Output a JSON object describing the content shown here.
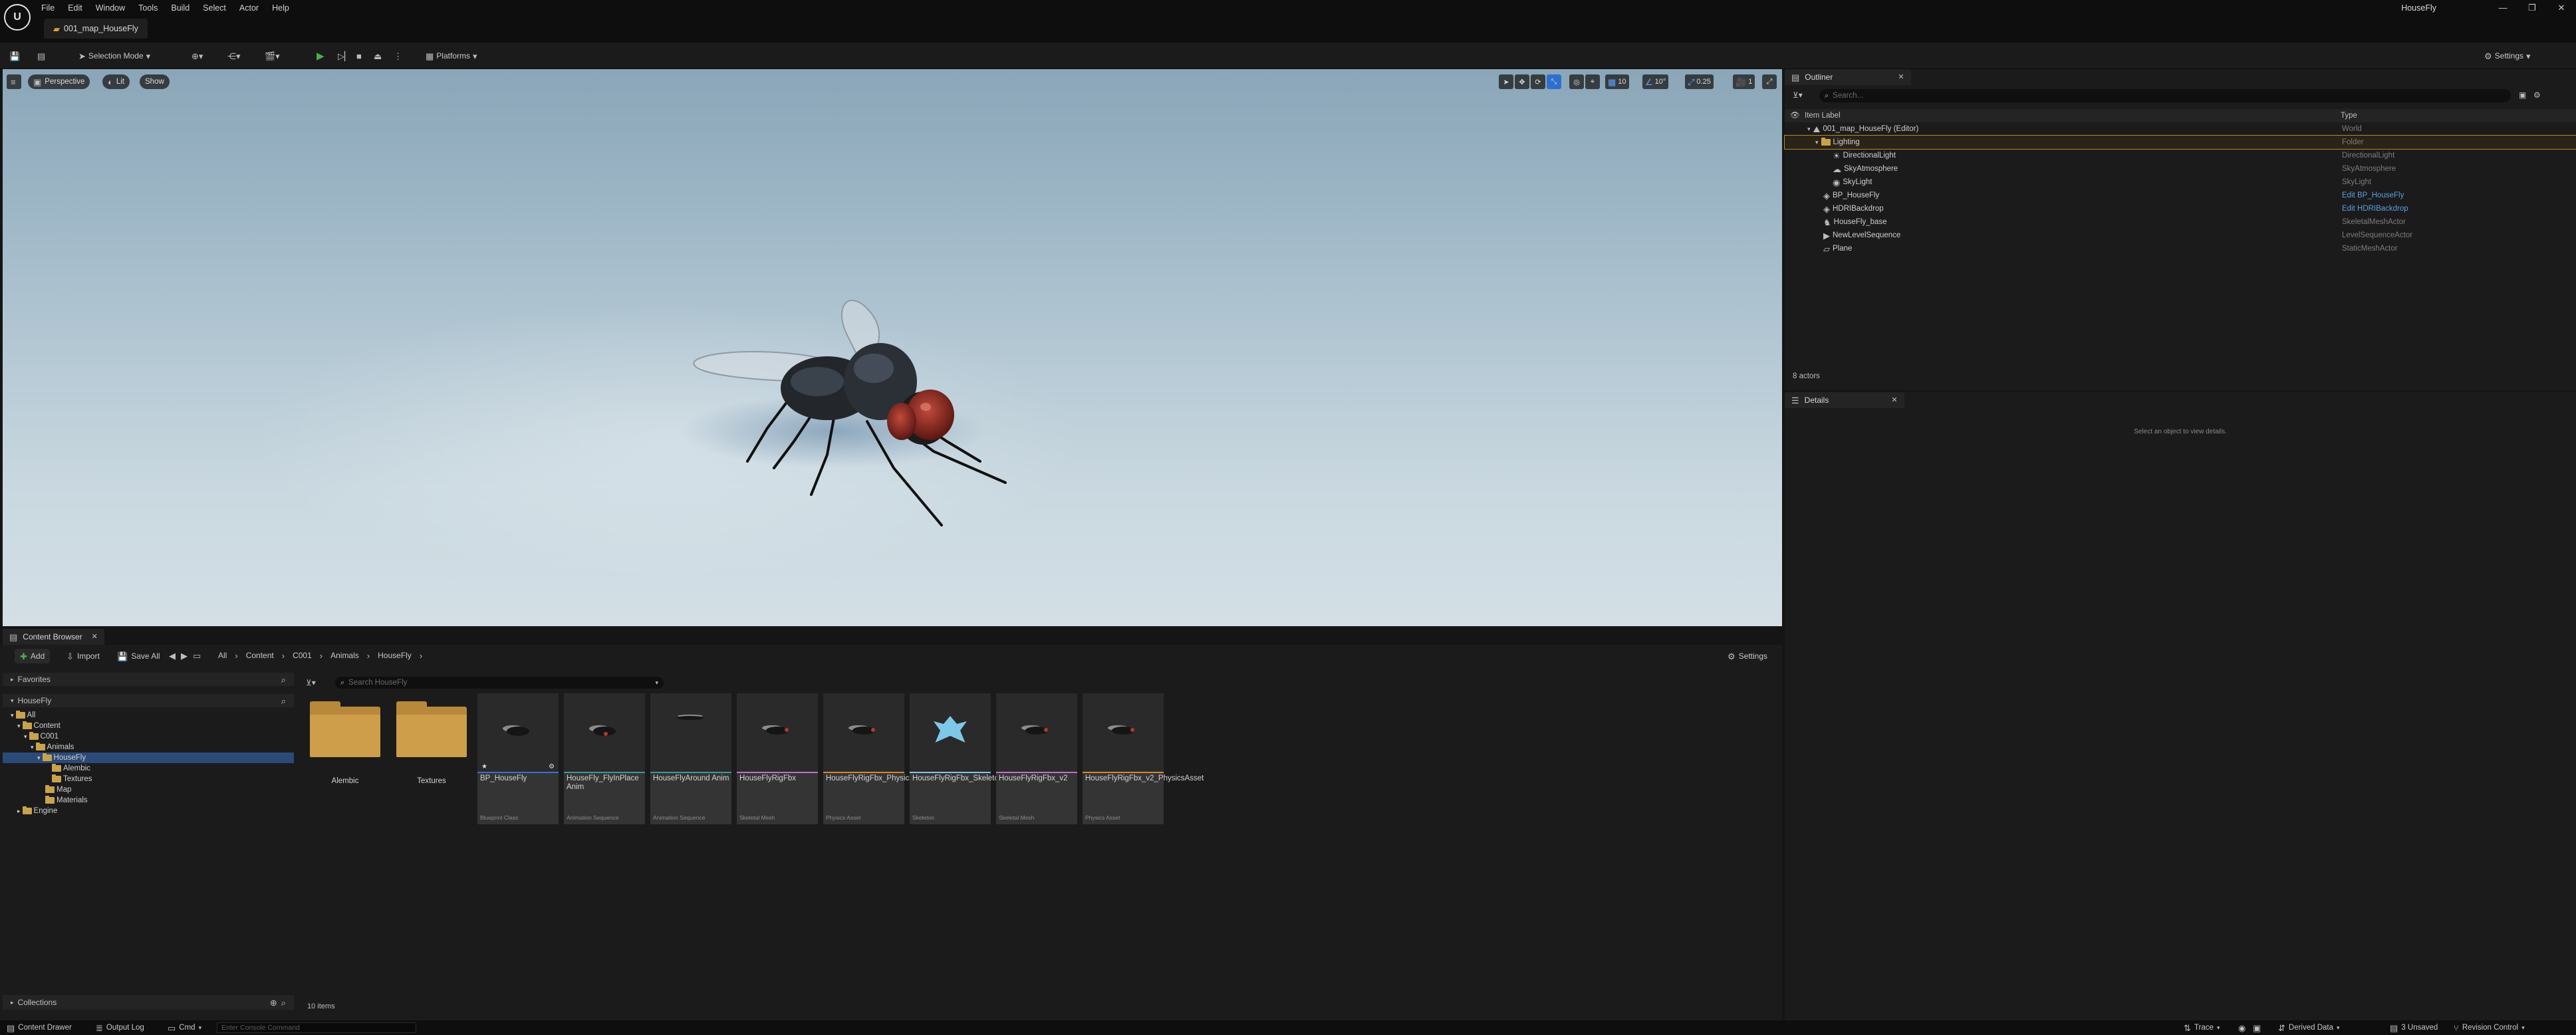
{
  "menu": [
    "File",
    "Edit",
    "Window",
    "Tools",
    "Build",
    "Select",
    "Actor",
    "Help"
  ],
  "window_title": "HouseFly",
  "window_controls": [
    "—",
    "❐",
    "✕"
  ],
  "map_tab": "001_map_HouseFly",
  "toolbar": {
    "selection_mode": "Selection Mode",
    "platforms": "Platforms",
    "settings": "Settings"
  },
  "viewport": {
    "perspective": "Perspective",
    "lit": "Lit",
    "show": "Show",
    "grid_snap": "10",
    "angle_snap": "10°",
    "scale_snap": "0.25",
    "camera_speed": "1"
  },
  "outliner": {
    "tab": "Outliner",
    "search_placeholder": "Search...",
    "col_label": "Item Label",
    "col_type": "Type",
    "items": [
      {
        "label": "001_map_HouseFly (Editor)",
        "type": "World"
      },
      {
        "label": "Lighting",
        "type": "Folder"
      },
      {
        "label": "DirectionalLight",
        "type": "DirectionalLight"
      },
      {
        "label": "SkyAtmosphere",
        "type": "SkyAtmosphere"
      },
      {
        "label": "SkyLight",
        "type": "SkyLight"
      },
      {
        "label": "BP_HouseFly",
        "type": "Edit BP_HouseFly"
      },
      {
        "label": "HDRIBackdrop",
        "type": "Edit HDRIBackdrop"
      },
      {
        "label": "HouseFly_base",
        "type": "SkeletalMeshActor"
      },
      {
        "label": "NewLevelSequence",
        "type": "LevelSequenceActor"
      },
      {
        "label": "Plane",
        "type": "StaticMeshActor"
      }
    ],
    "count": "8 actors"
  },
  "details": {
    "tab": "Details",
    "empty": "Select an object to view details."
  },
  "content_browser": {
    "tab": "Content Browser",
    "add": "Add",
    "import": "Import",
    "save_all": "Save All",
    "breadcrumb": [
      "All",
      "Content",
      "C001",
      "Animals",
      "HouseFly"
    ],
    "settings": "Settings",
    "favorites": "Favorites",
    "root": "HouseFly",
    "search_placeholder": "Search HouseFly",
    "tree": [
      "All",
      "Content",
      "C001",
      "Animals",
      "HouseFly",
      "Alembic",
      "Textures",
      "Map",
      "Materials",
      "Engine"
    ],
    "assets": [
      {
        "name": "Alembic",
        "class": ""
      },
      {
        "name": "Textures",
        "class": ""
      },
      {
        "name": "BP_HouseFly",
        "class": "Blueprint Class",
        "color": "#3b6fd8"
      },
      {
        "name": "HouseFly_FlyInPlace Anim",
        "class": "Animation Sequence",
        "color": "#3b9a9a"
      },
      {
        "name": "HouseFlyAround Anim",
        "class": "Animation Sequence",
        "color": "#3b9a9a"
      },
      {
        "name": "HouseFlyRigFbx",
        "class": "Skeletal Mesh",
        "color": "#c06fd0"
      },
      {
        "name": "HouseFlyRigFbx_PhysicsAsset",
        "class": "Physics Asset",
        "color": "#d08a30"
      },
      {
        "name": "HouseFlyRigFbx_Skeleton",
        "class": "Skeleton",
        "color": "#7ec7e8"
      },
      {
        "name": "HouseFlyRigFbx_v2",
        "class": "Skeletal Mesh",
        "color": "#c06fd0"
      },
      {
        "name": "HouseFlyRigFbx_v2_PhysicsAsset",
        "class": "Physics Asset",
        "color": "#d08a30"
      }
    ],
    "item_count": "10 items",
    "collections": "Collections"
  },
  "status": {
    "content_drawer": "Content Drawer",
    "output_log": "Output Log",
    "cmd": "Cmd",
    "console_placeholder": "Enter Console Command",
    "trace": "Trace",
    "derived_data": "Derived Data",
    "unsaved": "3 Unsaved",
    "revision_control": "Revision Control"
  }
}
